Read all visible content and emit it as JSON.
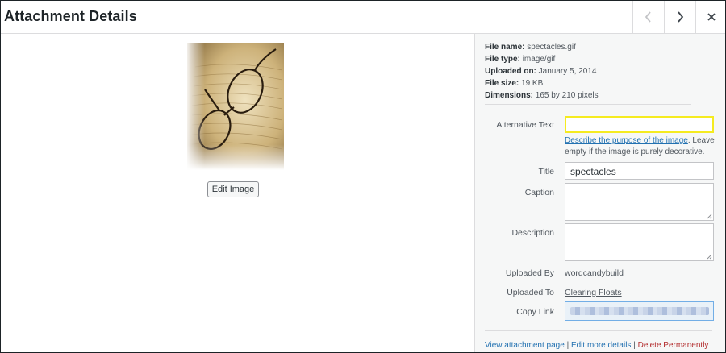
{
  "header": {
    "title": "Attachment Details",
    "prev_icon": "chevron-left-icon",
    "next_icon": "chevron-right-icon",
    "close_icon": "close-icon"
  },
  "media": {
    "image_icon": "spectacles-photo",
    "edit_button": "Edit Image"
  },
  "details": {
    "file_name_label": "File name:",
    "file_name": "spectacles.gif",
    "file_type_label": "File type:",
    "file_type": "image/gif",
    "uploaded_on_label": "Uploaded on:",
    "uploaded_on": "January 5, 2014",
    "file_size_label": "File size:",
    "file_size": "19 KB",
    "dimensions_label": "Dimensions:",
    "dimensions": "165 by 210 pixels"
  },
  "form": {
    "alt_label": "Alternative Text",
    "alt_value": "",
    "alt_help_link": "Describe the purpose of the image",
    "alt_help_rest": ". Leave empty if the image is purely decorative.",
    "title_label": "Title",
    "title_value": "spectacles",
    "caption_label": "Caption",
    "caption_value": "",
    "description_label": "Description",
    "description_value": "",
    "uploaded_by_label": "Uploaded By",
    "uploaded_by": "wordcandybuild",
    "uploaded_to_label": "Uploaded To",
    "uploaded_to": "Clearing Floats",
    "copy_link_label": "Copy Link"
  },
  "actions": {
    "view_page": "View attachment page",
    "separator": "|",
    "edit_more": "Edit more details",
    "delete": "Delete Permanently"
  },
  "colors": {
    "focus_highlight": "#f5eb20",
    "link": "#2271b1",
    "danger": "#b32d2e"
  }
}
